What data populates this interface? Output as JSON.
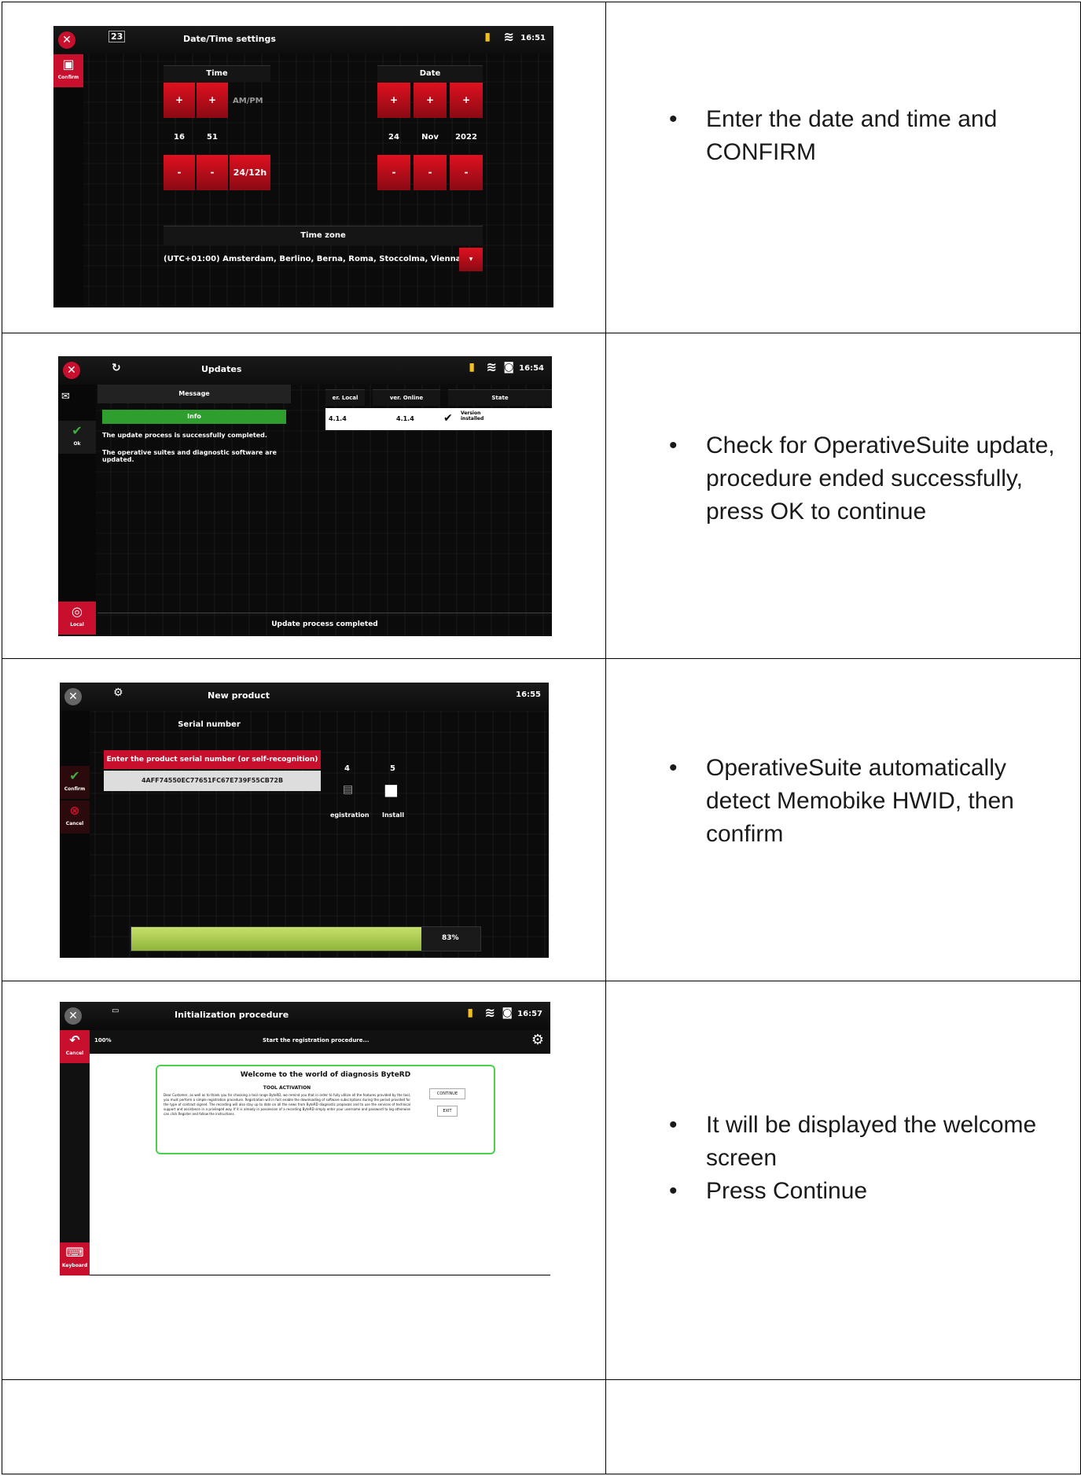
{
  "rows": [
    {
      "bullets": [
        "Enter the date and time and CONFIRM"
      ],
      "screen": {
        "title": "Date/Time settings",
        "clock": "16:51",
        "calendar_day": "23",
        "sidebar_confirm": "Confirm",
        "time_header": "Time",
        "ampm": "AM/PM",
        "hour": "16",
        "minute": "51",
        "mode": "24/12h",
        "date_header": "Date",
        "day": "24",
        "month": "Nov",
        "year": "2022",
        "plus": "+",
        "minus": "-",
        "timezone_header": "Time zone",
        "timezone_value": "(UTC+01:00) Amsterdam, Berlino, Berna, Roma, Stoccolma, Vienna"
      }
    },
    {
      "bullets": [
        "Check for OperativeSuite update, procedure ended successfully, press OK to continue"
      ],
      "screen": {
        "title": "Updates",
        "clock": "16:54",
        "message_label": "Message",
        "info_label": "Info",
        "line1": "The update process is successfully completed.",
        "line2": "The operative suites and diagnostic software are updated.",
        "col_local": "er. Local",
        "col_online": "ver. Online",
        "col_state": "State",
        "ver_local": "4.1.4",
        "ver_online": "4.1.4",
        "state": "Version installed",
        "ok_label": "Ok",
        "local_label": "Local",
        "footer": "Update process completed"
      }
    },
    {
      "bullets": [
        "OperativeSuite automatically detect Memobike HWID, then confirm"
      ],
      "screen": {
        "title": "New product",
        "clock": "16:55",
        "serial_header": "Serial number",
        "prompt": "Enter the product serial number (or self-recognition)",
        "serial_value": "4AFF74550EC77651FC67E739F55CB72B",
        "confirm": "Confirm",
        "cancel": "Cancel",
        "step4": "4",
        "step5": "5",
        "registration": "egistration",
        "install": "Install",
        "progress_label": "83%",
        "progress": 0.83
      }
    },
    {
      "bullets": [
        "It will be displayed the welcome screen",
        "Press Continue"
      ],
      "screen": {
        "title": "Initialization procedure",
        "clock": "16:57",
        "percent": "100%",
        "status": "Start the registration procedure...",
        "cancel": "Cancel",
        "keyboard": "Keyboard",
        "welcome_title": "Welcome to the world of diagnosis ByteRD",
        "activation": "TOOL ACTIVATION",
        "body": "Dear Customer, as well as to thank you for choosing a tool range ByteRD, we remind you that in order to fully utilize all the features provided by the tool, you must perform a simple registration procedure. Registration will in fact enable the downloading of software subscriptions during the period provided for the type of contract signed. The recording will also stay up to date on all the news from ByteRD diagnostic proposals and to use the services of technical support and assistance in a privileged way. If it is already in possession of a recording ByteRD simply enter your username and password to log otherwise can click Register and follow the instructions.",
        "continue": "CONTINUE",
        "exit": "EXIT"
      }
    }
  ]
}
